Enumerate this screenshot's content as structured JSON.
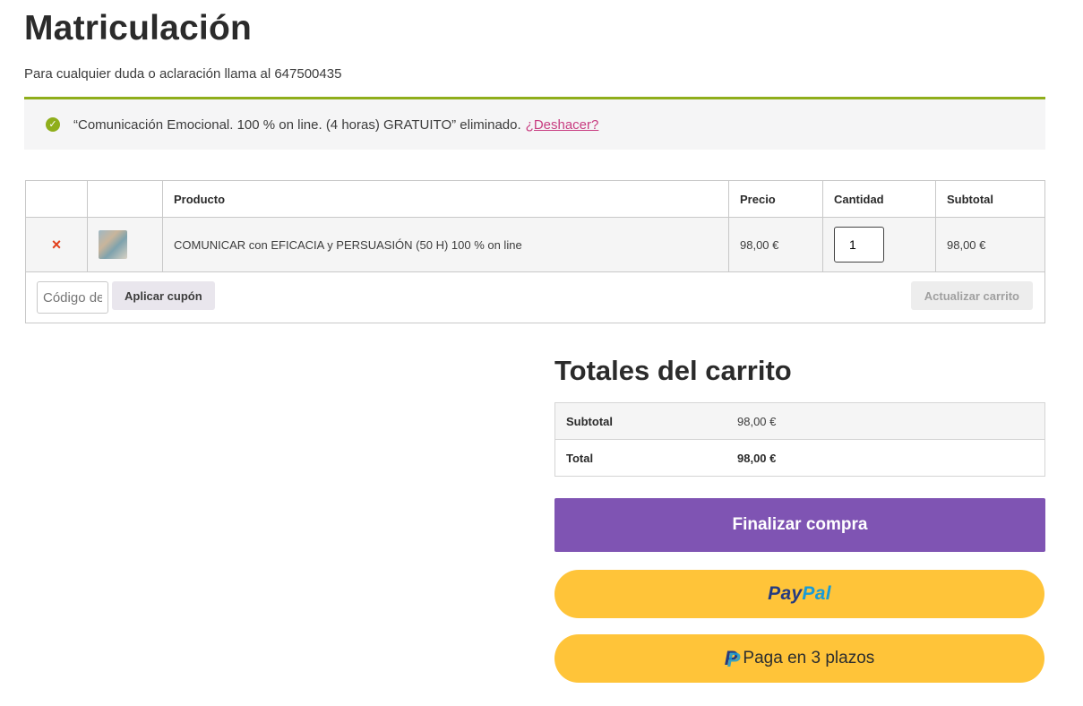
{
  "page": {
    "title": "Matriculación",
    "subtitle": "Para cualquier duda o aclaración llama al 647500435"
  },
  "notice": {
    "message": "“Comunicación Emocional. 100 % on line. (4 horas) GRATUITO” eliminado.",
    "undo_label": "¿Deshacer?"
  },
  "cart": {
    "headers": {
      "product": "Producto",
      "price": "Precio",
      "quantity": "Cantidad",
      "subtotal": "Subtotal"
    },
    "items": [
      {
        "remove_symbol": "×",
        "name": "COMUNICAR con EFICACIA y PERSUASIÓN (50 H) 100 % on line",
        "price": "98,00 €",
        "quantity": "1",
        "subtotal": "98,00 €"
      }
    ],
    "coupon_placeholder": "Código de cupón",
    "apply_label": "Aplicar cupón",
    "update_label": "Actualizar carrito"
  },
  "totals": {
    "title": "Totales del carrito",
    "subtotal_label": "Subtotal",
    "subtotal_value": "98,00 €",
    "total_label": "Total",
    "total_value": "98,00 €"
  },
  "checkout_label": "Finalizar compra",
  "paypal": {
    "brand_part1": "Pay",
    "brand_part2": "Pal",
    "pay_later_label": "Paga en 3 plazos"
  },
  "colors": {
    "accent_green": "#8fae1b",
    "link_pink": "#c83c80",
    "checkout_purple": "#7f54b3",
    "paypal_yellow": "#ffc439",
    "remove_red": "#e2401c"
  }
}
